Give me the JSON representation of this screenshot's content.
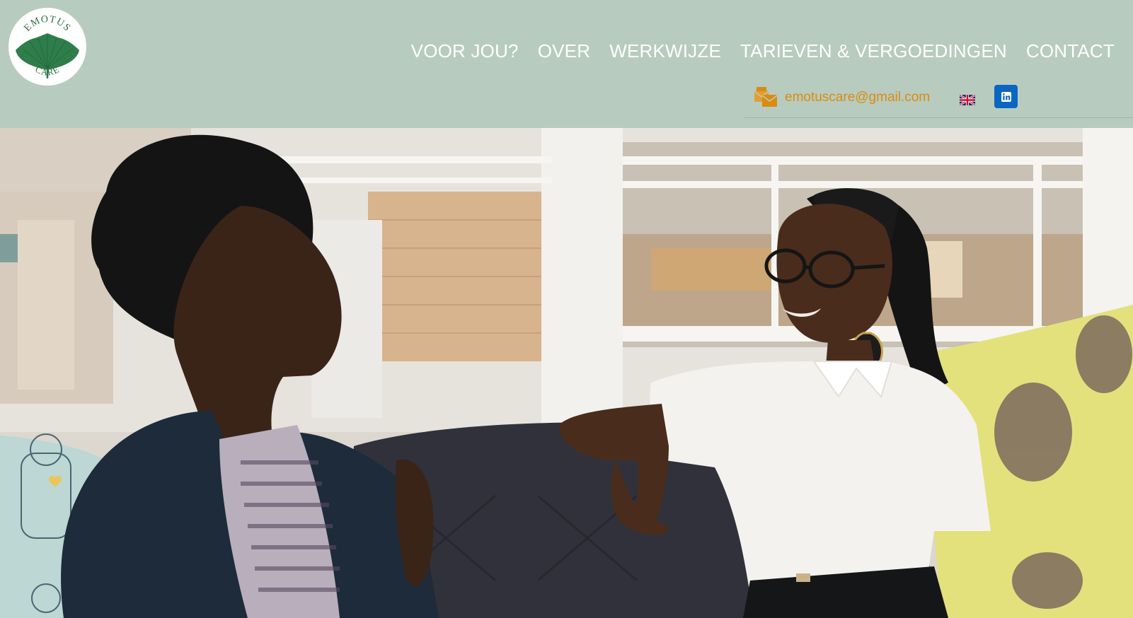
{
  "brand": {
    "logo_top_text": "EMOTUS",
    "logo_bottom_text": "CARE",
    "logo_icon": "ginkgo-leaf-icon",
    "primary_green": "#2e7d4a",
    "header_bg": "#b8cbbf"
  },
  "nav": {
    "items": [
      {
        "label": "VOOR JOU?"
      },
      {
        "label": "OVER"
      },
      {
        "label": "WERKWIJZE"
      },
      {
        "label": "TARIEVEN & VERGOEDINGEN"
      },
      {
        "label": "CONTACT"
      }
    ]
  },
  "contact": {
    "email": "emotuscare@gmail.com",
    "email_icon": "mail-stack-icon",
    "email_color": "#d98c10",
    "language_icon": "uk-flag-icon",
    "social_icon": "linkedin-icon",
    "linkedin_color": "#0a66c2"
  },
  "hero": {
    "image": "two-people-talking-on-sofa-photo"
  }
}
